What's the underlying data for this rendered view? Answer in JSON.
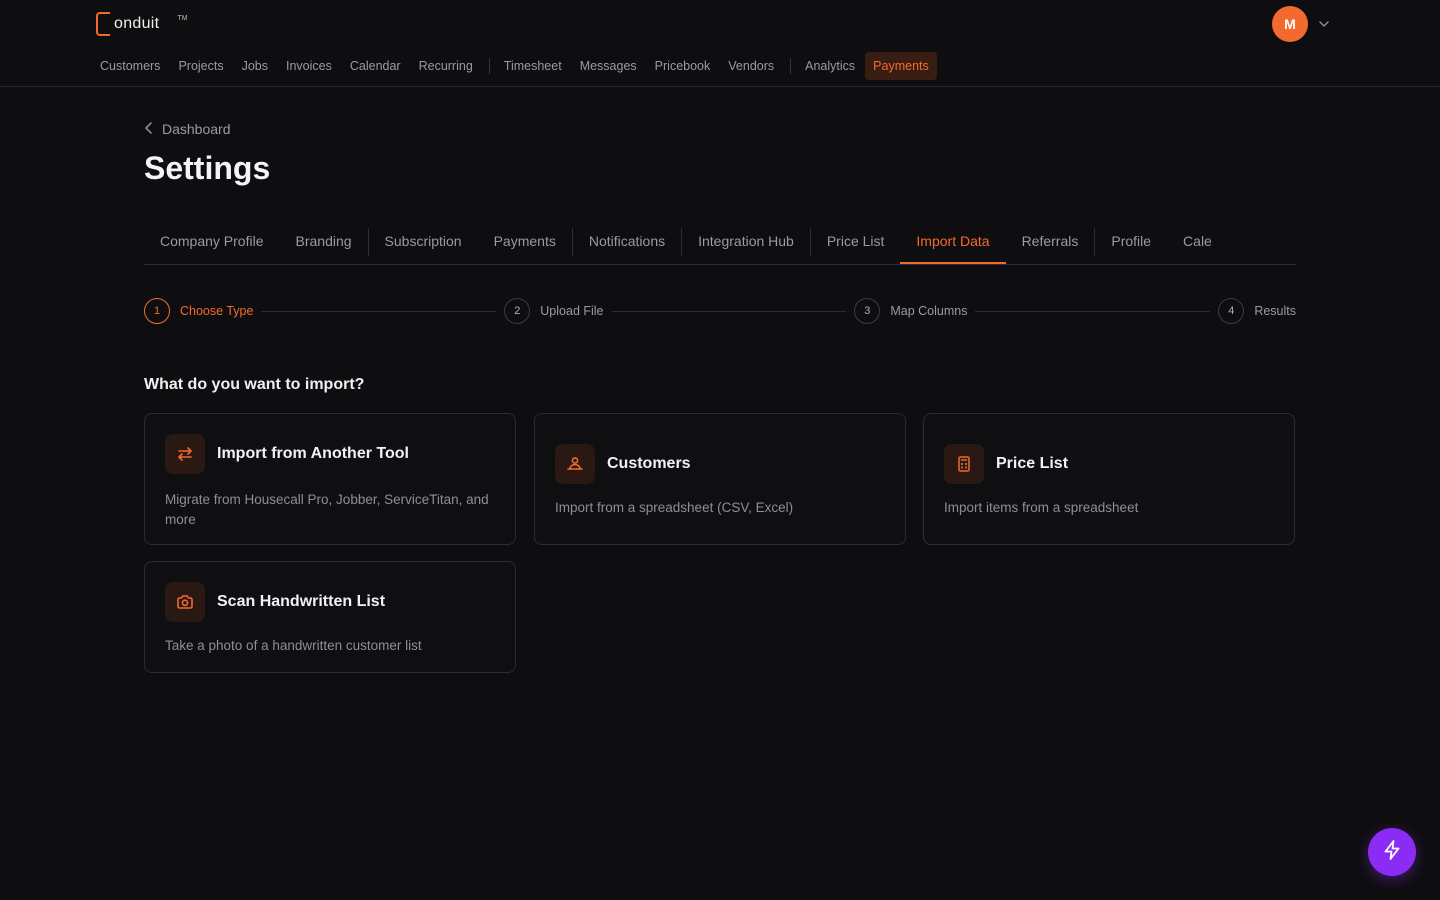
{
  "brand": {
    "name": "onduit",
    "tm": "TM"
  },
  "user": {
    "initial": "M"
  },
  "nav": {
    "items": [
      "Customers",
      "Projects",
      "Jobs",
      "Invoices",
      "Calendar",
      "Recurring",
      "Timesheet",
      "Messages",
      "Pricebook",
      "Vendors",
      "Analytics",
      "Payments"
    ],
    "active": "Payments"
  },
  "breadcrumb": {
    "label": "Dashboard"
  },
  "page": {
    "title": "Settings"
  },
  "tabs": {
    "items": [
      "Company Profile",
      "Branding",
      "Subscription",
      "Payments",
      "Notifications",
      "Integration Hub",
      "Price List",
      "Import Data",
      "Referrals",
      "Profile",
      "Cale"
    ],
    "active": "Import Data"
  },
  "stepper": {
    "steps": [
      {
        "number": "1",
        "label": "Choose Type"
      },
      {
        "number": "2",
        "label": "Upload File"
      },
      {
        "number": "3",
        "label": "Map Columns"
      },
      {
        "number": "4",
        "label": "Results"
      }
    ],
    "active": "1"
  },
  "import": {
    "question": "What do you want to import?",
    "cards": [
      {
        "icon": "swap-arrows-icon",
        "title": "Import from Another Tool",
        "desc": "Migrate from Housecall Pro, Jobber, ServiceTitan, and more"
      },
      {
        "icon": "users-icon",
        "title": "Customers",
        "desc": "Import from a spreadsheet (CSV, Excel)"
      },
      {
        "icon": "calculator-icon",
        "title": "Price List",
        "desc": "Import items from a spreadsheet"
      },
      {
        "icon": "camera-icon",
        "title": "Scan Handwritten List",
        "desc": "Take a photo of a handwritten customer list"
      }
    ]
  },
  "colors": {
    "accent": "#f26a2e",
    "background": "#0e0e10",
    "fab": "#8b2cf5"
  }
}
